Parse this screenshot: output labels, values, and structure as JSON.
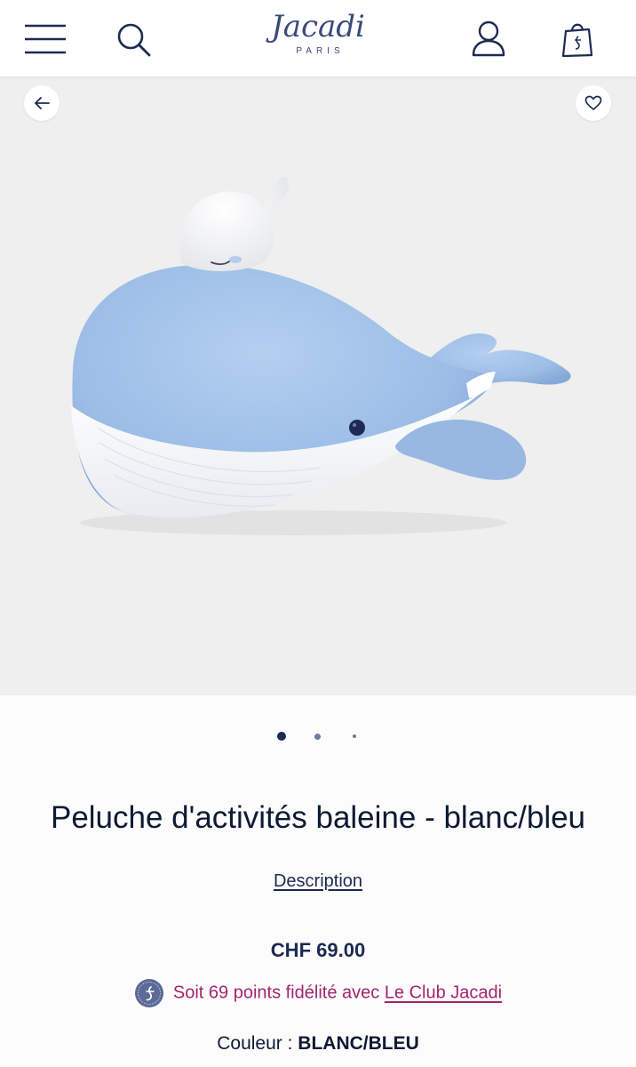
{
  "header": {
    "logo_text": "Jacadi",
    "logo_subtext": "PARIS",
    "icons": [
      "menu-icon",
      "search-icon",
      "account-icon",
      "shopping-bag-icon"
    ]
  },
  "gallery": {
    "image_alt": "whale plush",
    "slide_count": 3,
    "active_slide": 1,
    "icons": [
      "arrow-left-icon",
      "heart-icon"
    ],
    "background": "#efefef"
  },
  "product": {
    "title": "Peluche d'activités baleine - blanc/bleu",
    "description_link": "Description",
    "price": "CHF 69.00"
  },
  "loyalty": {
    "text": "Soit 69 points fidélité avec",
    "link": "Le Club Jacadi",
    "color": "#a3246f"
  },
  "color": {
    "label": "Couleur :",
    "value": "BLANC/BLEU"
  },
  "colors": {
    "navy": "#1c2a52",
    "logo": "#3a4a7a",
    "loyalty": "#a3246f"
  }
}
